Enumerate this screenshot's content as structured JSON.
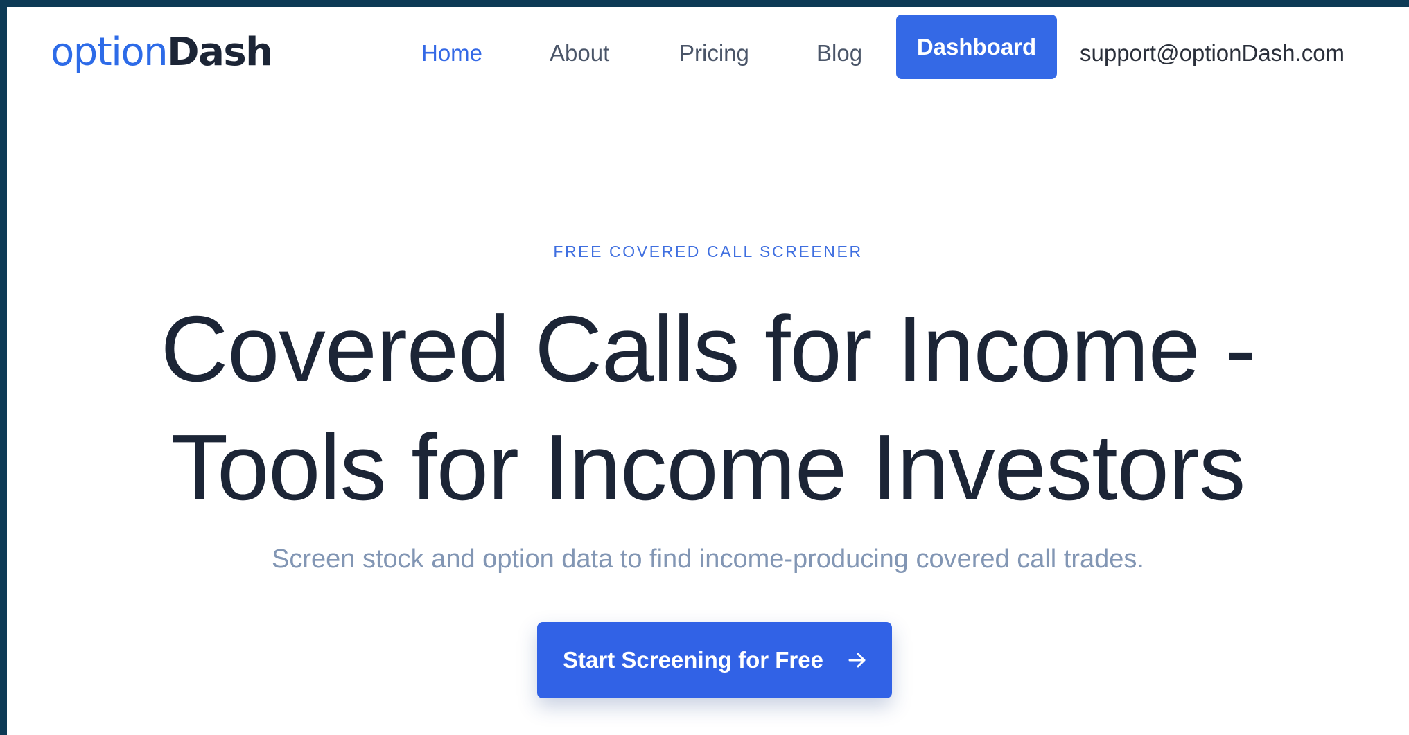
{
  "brand": {
    "logo_part1": "option",
    "logo_part2": "Dash"
  },
  "nav": {
    "home": "Home",
    "about": "About",
    "pricing": "Pricing",
    "blog": "Blog",
    "dashboard": "Dashboard",
    "email": "support@optionDash.com"
  },
  "hero": {
    "eyebrow": "FREE COVERED CALL SCREENER",
    "headline_line1": "Covered Calls for Income -",
    "headline_line2": "Tools for Income Investors",
    "subtitle": "Screen stock and option data to find income-producing covered call trades.",
    "cta_label": "Start Screening for Free",
    "cta_icon": "arrow-right-icon"
  },
  "colors": {
    "background_border": "#0d3a55",
    "accent": "#3469e6",
    "heading": "#1c2536",
    "subtitle": "#8296b4"
  }
}
